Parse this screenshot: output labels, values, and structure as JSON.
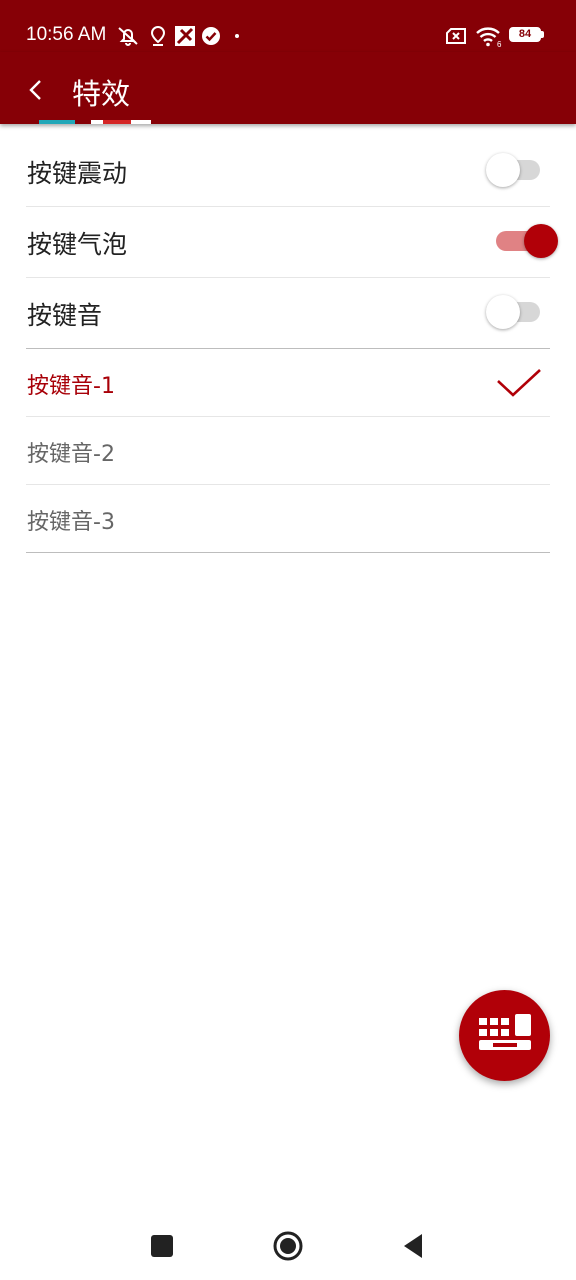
{
  "status_bar": {
    "time": "10:56 AM",
    "battery": "84",
    "icons": [
      "muted-bell-icon",
      "location-pin-icon",
      "app-notification-icon",
      "check-badge-icon",
      "sim-off-icon",
      "wifi-icon",
      "battery-icon"
    ]
  },
  "app_bar": {
    "title": "特效",
    "back_icon": "back-arrow-icon"
  },
  "settings": {
    "key_vibration": {
      "label": "按键震动",
      "enabled": false
    },
    "key_bubble": {
      "label": "按键气泡",
      "enabled": true
    },
    "key_sound": {
      "label": "按键音",
      "enabled": false
    },
    "sound_options": [
      {
        "label": "按键音-1",
        "selected": true
      },
      {
        "label": "按键音-2",
        "selected": false
      },
      {
        "label": "按键音-3",
        "selected": false
      }
    ]
  },
  "fab": {
    "icon": "keyboard-icon"
  },
  "nav_bar": {
    "icons": [
      "recents-square-icon",
      "home-circle-icon",
      "back-triangle-icon"
    ]
  },
  "colors": {
    "primary_dark": "#860006",
    "accent": "#b10008",
    "switch_track_on": "#e08284"
  }
}
